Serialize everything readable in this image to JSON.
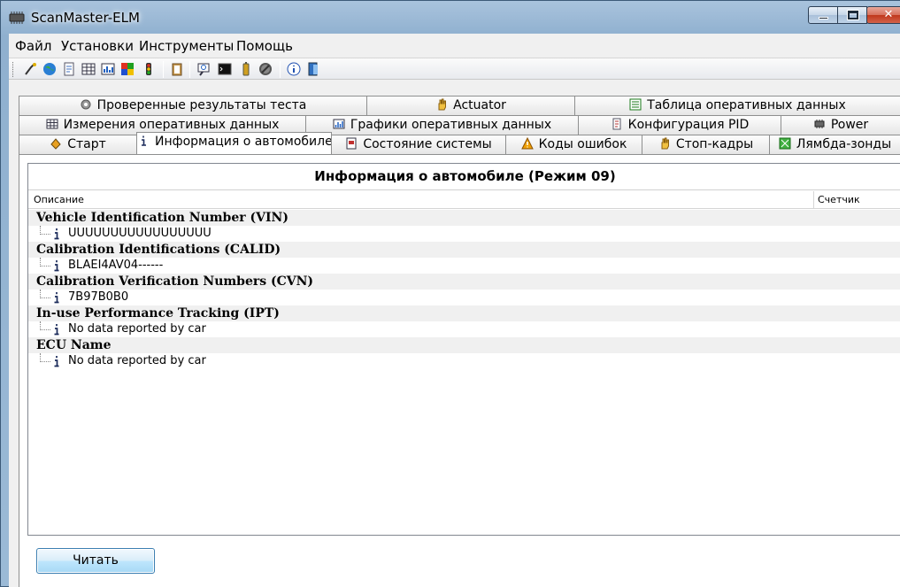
{
  "window": {
    "title": "ScanMaster-ELM"
  },
  "menu": [
    "Файл",
    "Установки",
    "Инструменты",
    "Помощь"
  ],
  "tabs": {
    "row1": [
      "Проверенные результаты теста",
      "Actuator",
      "Таблица оперативных данных"
    ],
    "row2": [
      "Измерения оперативных данных",
      "Графики оперативных данных",
      "Конфигурация PID",
      "Power"
    ],
    "row3": [
      "Старт",
      "Информация о автомобиле",
      "Состояние системы",
      "Коды ошибок",
      "Стоп-кадры",
      "Лямбда-зонды"
    ]
  },
  "panel": {
    "title": "Информация о автомобиле (Режим 09)",
    "columns": {
      "description": "Описание",
      "counter": "Счетчик"
    },
    "groups": [
      {
        "name": "Vehicle Identification Number (VIN)",
        "value": "UUUUUUUUUUUUUUUUU"
      },
      {
        "name": "Calibration Identifications (CALID)",
        "value": "BLAEI4AV04------"
      },
      {
        "name": "Calibration Verification Numbers (CVN)",
        "value": "7B97B0B0"
      },
      {
        "name": "In-use Performance Tracking (IPT)",
        "value": "No data reported by car"
      },
      {
        "name": "ECU Name",
        "value": "No data reported by car"
      }
    ],
    "read_button": "Читать"
  }
}
